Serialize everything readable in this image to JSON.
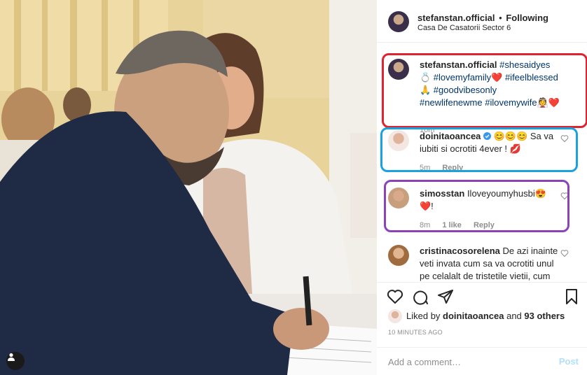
{
  "post": {
    "author": "stefanstan.official",
    "separator": "•",
    "follow_state": "Following",
    "location": "Casa De Casatorii Sector 6"
  },
  "caption": {
    "username": "stefanstan.official",
    "text": "#shesaidyes💍 #lovemyfamily❤️ #ifeelblessed🙏 #goodvibesonly #newlifenewme #ilovemywife👰❤️",
    "time": "10m"
  },
  "comments": [
    {
      "username": "doinitaoancea",
      "verified": true,
      "text": "😊😊😊 Sa va iubiti si ocrotiti 4ever ! 💋",
      "time": "5m",
      "likes": "",
      "reply": "Reply"
    },
    {
      "username": "simosstan",
      "verified": false,
      "text": "Iloveyoumyhusbi😍 ❤️!",
      "time": "8m",
      "likes": "1 like",
      "reply": "Reply"
    },
    {
      "username": "cristinacosorelena",
      "verified": false,
      "text": "De azi inainte veti invata cum sa va ocrotiti unul pe celalalt de tristetile vietii, cum",
      "time": "",
      "likes": "",
      "reply": ""
    }
  ],
  "likes": {
    "prefix": "Liked by",
    "liker": "doinitaoancea",
    "conj": "and",
    "others": "93 others"
  },
  "timestamp": "10 MINUTES AGO",
  "add_comment": {
    "placeholder": "Add a comment…",
    "post_label": "Post"
  },
  "icons": {
    "like": "heart-outline-icon",
    "comment": "speech-bubble-icon",
    "share": "paper-plane-icon",
    "save": "bookmark-icon",
    "tag": "user-tag-icon",
    "verified": "verified-badge-icon"
  },
  "colors": {
    "highlight_caption": "#e0232f",
    "highlight_comment_1": "#1aa1e0",
    "highlight_comment_2": "#8b43b5",
    "hashtag": "#003569",
    "post_disabled": "#b2dffc"
  }
}
